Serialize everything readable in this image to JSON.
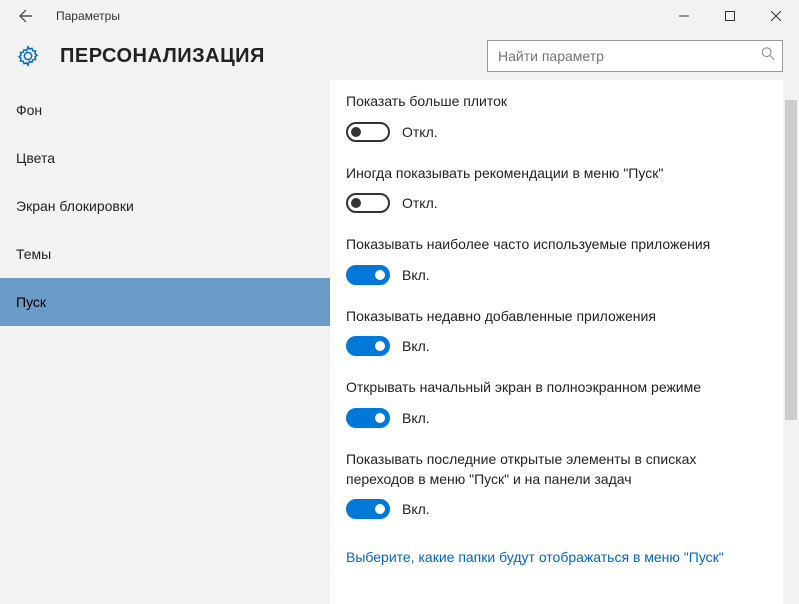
{
  "titlebar": {
    "title": "Параметры"
  },
  "header": {
    "page_title": "ПЕРСОНАЛИЗАЦИЯ"
  },
  "search": {
    "placeholder": "Найти параметр"
  },
  "sidebar": {
    "items": [
      {
        "label": "Фон"
      },
      {
        "label": "Цвета"
      },
      {
        "label": "Экран блокировки"
      },
      {
        "label": "Темы"
      },
      {
        "label": "Пуск"
      }
    ]
  },
  "toggle_labels": {
    "on": "Вкл.",
    "off": "Откл."
  },
  "settings": [
    {
      "label": "Показать больше плиток",
      "state": "off"
    },
    {
      "label": "Иногда показывать рекомендации в меню \"Пуск\"",
      "state": "off"
    },
    {
      "label": "Показывать наиболее часто используемые приложения",
      "state": "on"
    },
    {
      "label": "Показывать недавно добавленные приложения",
      "state": "on"
    },
    {
      "label": "Открывать начальный экран в полноэкранном режиме",
      "state": "on"
    },
    {
      "label": "Показывать последние открытые элементы в списках переходов в меню \"Пуск\" и на панели задач",
      "state": "on"
    }
  ],
  "link": {
    "label": "Выберите, какие папки будут отображаться в меню \"Пуск\""
  }
}
